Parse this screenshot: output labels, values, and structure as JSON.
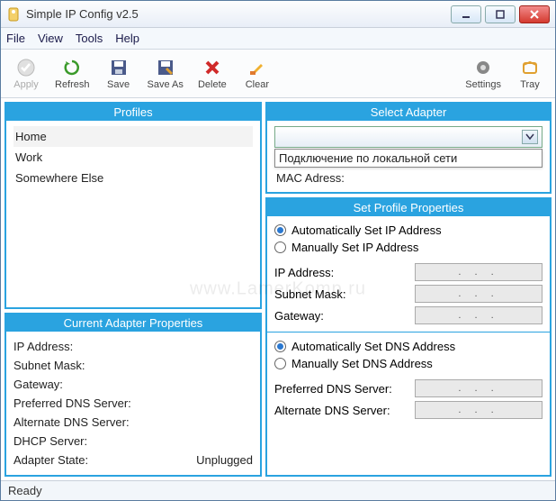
{
  "window": {
    "title": "Simple IP Config v2.5"
  },
  "menu": {
    "file": "File",
    "view": "View",
    "tools": "Tools",
    "help": "Help"
  },
  "toolbar": {
    "apply": "Apply",
    "refresh": "Refresh",
    "save": "Save",
    "save_as": "Save As",
    "delete": "Delete",
    "clear": "Clear",
    "settings": "Settings",
    "tray": "Tray"
  },
  "panels": {
    "profiles": "Profiles",
    "current_adapter": "Current Adapter Properties",
    "select_adapter": "Select Adapter",
    "set_profile": "Set Profile Properties"
  },
  "profiles": {
    "items": [
      "Home",
      "Work",
      "Somewhere Else"
    ]
  },
  "adapter": {
    "combo_value": "",
    "dropdown_item": "Подключение по локальной сети",
    "mac_label": "MAC Adress:",
    "mac_value": ""
  },
  "current_props": {
    "ip_label": "IP Address:",
    "ip_value": "",
    "subnet_label": "Subnet Mask:",
    "subnet_value": "",
    "gateway_label": "Gateway:",
    "gateway_value": "",
    "pref_dns_label": "Preferred DNS Server:",
    "pref_dns_value": "",
    "alt_dns_label": "Alternate DNS Server:",
    "alt_dns_value": "",
    "dhcp_label": "DHCP Server:",
    "dhcp_value": "",
    "state_label": "Adapter State:",
    "state_value": "Unplugged"
  },
  "profile_props": {
    "auto_ip": "Automatically Set IP Address",
    "manual_ip": "Manually Set IP Address",
    "ip_label": "IP Address:",
    "subnet_label": "Subnet Mask:",
    "gateway_label": "Gateway:",
    "auto_dns": "Automatically Set DNS Address",
    "manual_dns": "Manually Set DNS Address",
    "pref_dns_label": "Preferred DNS Server:",
    "alt_dns_label": "Alternate DNS Server:",
    "ip_placeholder": ".   .   ."
  },
  "status": {
    "text": "Ready"
  },
  "watermark": "www.LamerKomp.ru"
}
